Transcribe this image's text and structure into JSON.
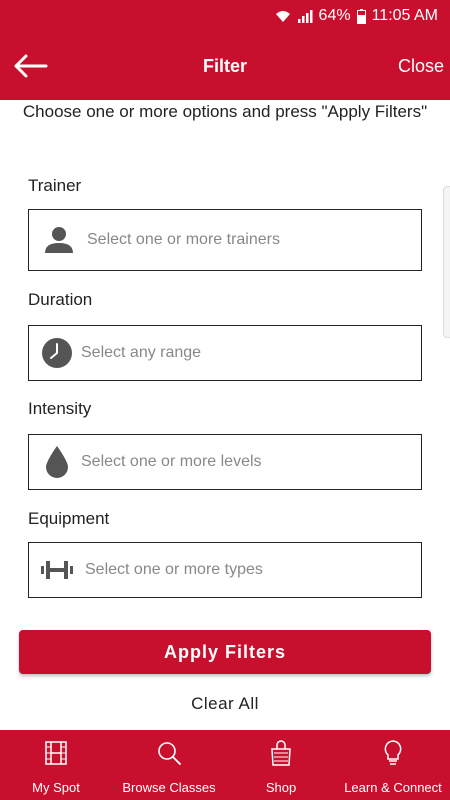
{
  "status_bar": {
    "battery": "64%",
    "time": "11:05 AM"
  },
  "header": {
    "title": "Filter",
    "close_label": "Close",
    "back_icon": "arrow-left-icon"
  },
  "instruction": "Choose one or more options and press \"Apply Filters\"",
  "fields": [
    {
      "label": "Trainer",
      "placeholder": "Select one or more trainers",
      "icon": "person-icon"
    },
    {
      "label": "Duration",
      "placeholder": "Select any range",
      "icon": "clock-icon"
    },
    {
      "label": "Intensity",
      "placeholder": "Select one or more levels",
      "icon": "drop-icon"
    },
    {
      "label": "Equipment",
      "placeholder": "Select one or more types",
      "icon": "dumbbell-icon"
    }
  ],
  "apply_label": "Apply Filters",
  "clear_label": "Clear All",
  "bottom_nav": [
    {
      "label": "My Spot",
      "icon": "film-icon"
    },
    {
      "label": "Browse Classes",
      "icon": "search-icon"
    },
    {
      "label": "Shop",
      "icon": "shopping-bag-icon"
    },
    {
      "label": "Learn & Connect",
      "icon": "lightbulb-icon"
    }
  ],
  "colors": {
    "brand": "#c8102e",
    "placeholder": "#888888",
    "icon": "#555555"
  }
}
